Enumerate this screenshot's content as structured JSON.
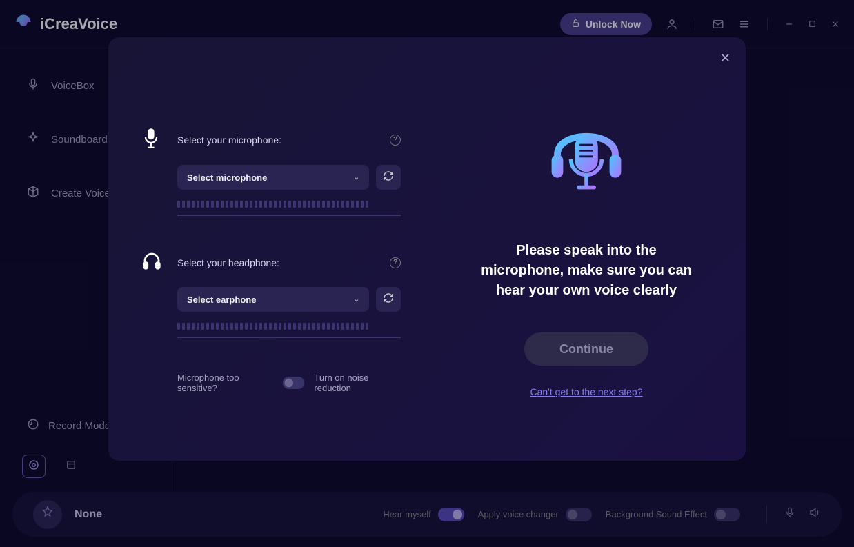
{
  "app": {
    "name": "iCreaVoice"
  },
  "titlebar": {
    "unlock_label": "Unlock Now",
    "icons": {
      "user": "user-icon",
      "mail": "mail-icon",
      "menu": "menu-icon",
      "min": "minimize-icon",
      "max": "maximize-icon",
      "close": "close-icon"
    }
  },
  "sidebar": {
    "items": [
      {
        "label": "VoiceBox",
        "icon": "microphone-icon"
      },
      {
        "label": "Soundboard",
        "icon": "sparkle-icon"
      },
      {
        "label": "Create Voices",
        "icon": "cube-icon"
      }
    ],
    "record_label": "Record Mode"
  },
  "bottombar": {
    "voice_name": "None",
    "toggles": {
      "hear_myself": {
        "label": "Hear myself",
        "on": true
      },
      "apply_changer": {
        "label": "Apply voice changer",
        "on": false
      },
      "bg_effect": {
        "label": "Background Sound Effect",
        "on": false
      }
    }
  },
  "modal": {
    "mic_label": "Select your microphone:",
    "mic_placeholder": "Select microphone",
    "hp_label": "Select your headphone:",
    "hp_placeholder": "Select earphone",
    "noise_q": "Microphone too sensitive?",
    "noise_action": "Turn on noise reduction",
    "instruction": "Please speak into the microphone, make sure you can hear your own voice clearly",
    "continue_label": "Continue",
    "help_link": "Can't get to the next step?"
  },
  "colors": {
    "accent": "#6a5fd8",
    "gradient_a": "#58c6ff",
    "gradient_b": "#a36bff"
  }
}
